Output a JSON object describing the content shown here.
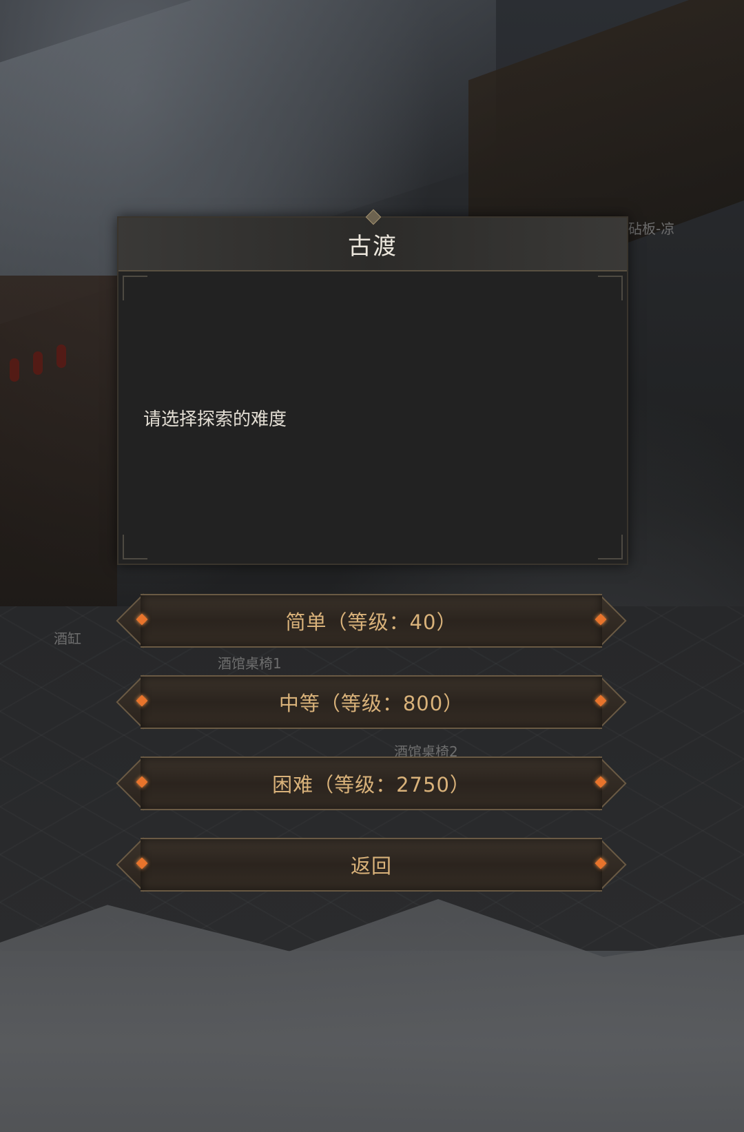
{
  "world_labels": {
    "chopping_board": "砧板-凉",
    "wine_jar": "酒缸",
    "tavern_table_1": "酒馆桌椅1",
    "tavern_table_2": "酒馆桌椅2"
  },
  "dialog": {
    "title": "古渡",
    "message": "请选择探索的难度"
  },
  "choices": {
    "easy": "简单（等级：40）",
    "medium": "中等（等级：800）",
    "hard": "困难（等级：2750）",
    "back": "返回"
  },
  "colors": {
    "button_text": "#d9b27a",
    "gem": "#e8742c",
    "panel": "#222222"
  }
}
